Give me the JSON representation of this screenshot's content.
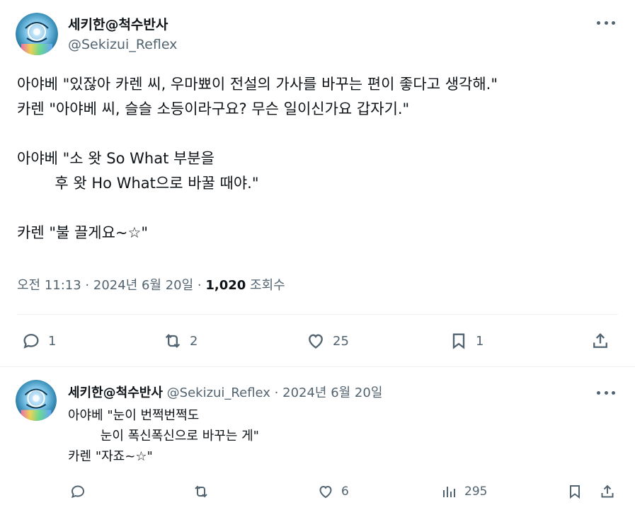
{
  "main_tweet": {
    "display_name": "세키한@척수반사",
    "handle": "@Sekizui_Reflex",
    "lines": [
      "아야베 \"있잖아 카렌 씨, 우마뾰이 전설의 가사를 바꾸는 편이 좋다고 생각해.\"",
      "카렌 \"아야베 씨, 슬슬 소등이라구요? 무슨 일이신가요 갑자기.\"",
      "",
      "아야베 \"소 왓 So What 부분을",
      "        후 왓 Ho What으로 바꿀 때야.\"",
      "",
      "카렌 \"불 끌게요~☆\""
    ],
    "timestamp": "오전 11:13 · 2024년 6월 20일 · ",
    "views_count": "1,020",
    "views_label": " 조회수",
    "actions": {
      "reply_count": "1",
      "retweet_count": "2",
      "like_count": "25",
      "bookmark_count": "1"
    }
  },
  "reply_tweet": {
    "display_name": "세키한@척수반사",
    "handle_date": " @Sekizui_Reflex · 2024년 6월 20일",
    "lines": [
      "아야베 \"눈이 번쩍번쩍도",
      "        눈이 폭신폭신으로 바꾸는 게\"",
      "카렌 \"자죠~☆\""
    ],
    "actions": {
      "like_count": "6",
      "views_count": "295"
    }
  },
  "colors": {
    "text": "#0f1419",
    "secondary": "#536471",
    "divider": "#eff3f4"
  },
  "icons": [
    "reply-icon",
    "retweet-icon",
    "like-icon",
    "bookmark-icon",
    "share-icon",
    "views-icon",
    "more-icon"
  ]
}
